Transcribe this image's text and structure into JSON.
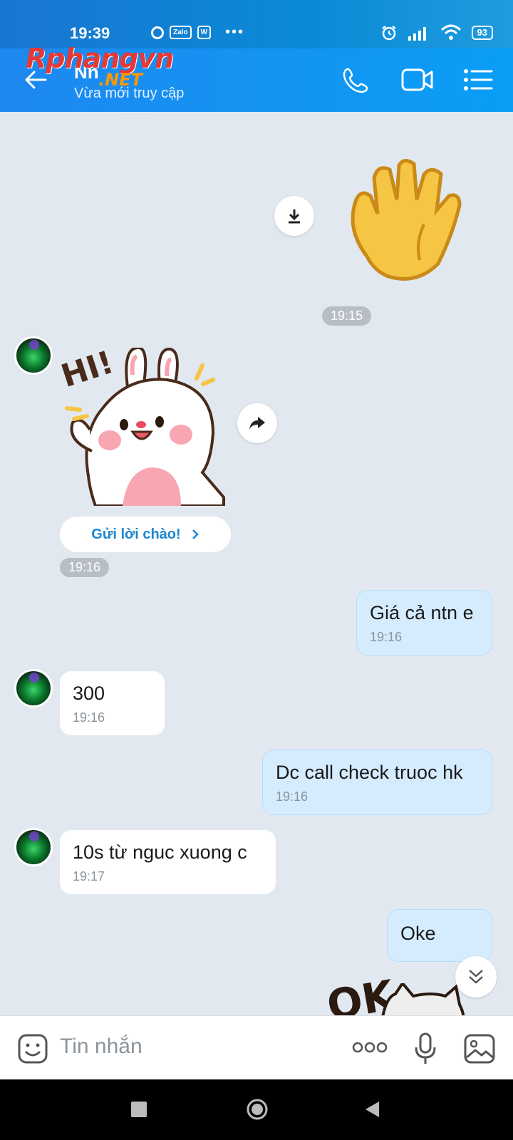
{
  "status_bar": {
    "time": "19:39",
    "app1": "Zalo",
    "app2": "W",
    "dots": "•••",
    "battery": "93"
  },
  "header": {
    "contact_name": "Nn",
    "contact_status": "Vừa mới truy cập",
    "watermark": "Rphangvn",
    "watermark_sub": ".NET"
  },
  "messages": {
    "ts_1915": "19:15",
    "greet_button": "Gửi lời chào!",
    "ts_1916": "19:16",
    "m1": {
      "text": "Giá cả ntn e",
      "time": "19:16"
    },
    "m2": {
      "text": "300",
      "time": "19:16"
    },
    "m3": {
      "text": "Dc call check truoc hk",
      "time": "19:16"
    },
    "m4": {
      "text": "10s từ nguc xuong c",
      "time": "19:17"
    },
    "m5": {
      "text": "Oke"
    },
    "ok_sticker": "OK",
    "hi_sticker": "HI!"
  },
  "input": {
    "placeholder": "Tin nhắn"
  },
  "colors": {
    "header": "#0a9ef5",
    "outgoing_bubble": "#d5ecfe",
    "background": "#e2e8f0",
    "accent": "#1b86d0"
  }
}
